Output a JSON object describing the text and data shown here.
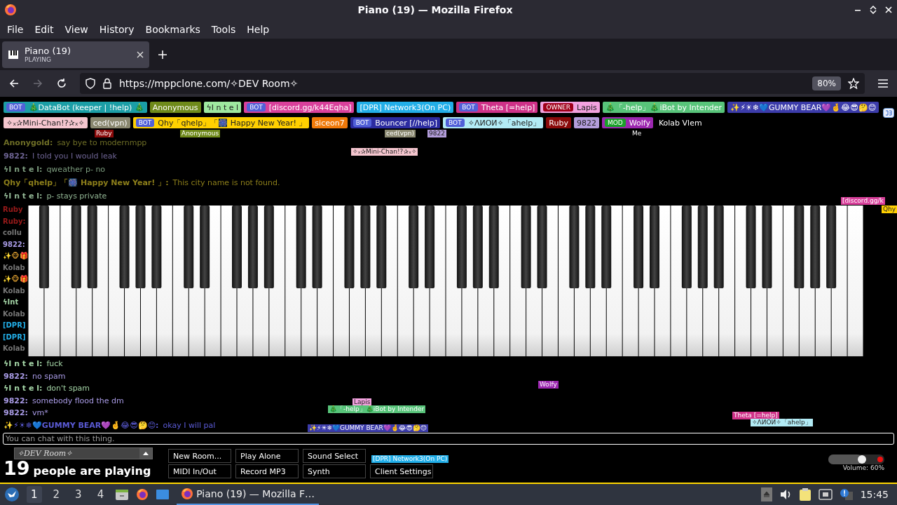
{
  "window": {
    "title": "Piano (19) — Mozilla Firefox"
  },
  "menu": [
    "File",
    "Edit",
    "View",
    "History",
    "Bookmarks",
    "Tools",
    "Help"
  ],
  "tabs": [
    {
      "title": "Piano (19)",
      "subtitle": "PLAYING",
      "selected": true
    }
  ],
  "nav": {
    "url": "https://mppclone.com/✧DEV Room✧",
    "zoom": "80%",
    "forward_disabled": true
  },
  "user_rows": [
    [
      {
        "name": "🎄DataBot (keeper | !help) 🎄",
        "color": "#1b9ea6",
        "badge": {
          "label": "BOT",
          "color": "#5160d8"
        }
      },
      {
        "name": "Anonymous",
        "color": "#6f8a1a"
      },
      {
        "name": "ϟI n t e l",
        "color": "#9fe8a0"
      },
      {
        "name": "[discord.gg/k44Eqha]",
        "color": "#d9409b",
        "badge": {
          "label": "BOT",
          "color": "#5160d8"
        }
      },
      {
        "name": "[DPR] Network3(On PC)",
        "color": "#22aee8"
      },
      {
        "name": "Theta [=help]",
        "color": "#cf3188",
        "badge": {
          "label": "BOT",
          "color": "#5160d8"
        }
      },
      {
        "name": "Lapis",
        "color": "#f3a2df",
        "badge": {
          "label": "OWNER",
          "color": "#a0001a"
        }
      },
      {
        "name": "🎄「-help」🎄iBot by Intender",
        "color": "#58c47a"
      },
      {
        "name": "✨⚡☀❄💙GUMMY BEAR💜🤞😂😎🤔😊",
        "color": "#3c3caa"
      }
    ],
    [
      {
        "name": "✧ₓ✰Mini-Chan!?✰ₓ✧",
        "color": "#f5c6cf"
      },
      {
        "name": "ced(vpn)",
        "color": "#8a8870"
      },
      {
        "name": "Qhy「qhelp」「🎆 Happy New Year! 」",
        "color": "#ffd000",
        "badge": {
          "label": "BOT",
          "color": "#5160d8"
        }
      },
      {
        "name": "siceon7",
        "color": "#f07a0a"
      },
      {
        "name": "Bouncer [//help]",
        "color": "#2c2ca0",
        "badge": {
          "label": "BOT",
          "color": "#5160d8"
        }
      },
      {
        "name": "✧ΛИОИ✧「ahelp」",
        "color": "#b2ebf5",
        "badge": {
          "label": "BOT",
          "color": "#5160d8"
        }
      },
      {
        "name": "Ruby",
        "color": "#8a0a0a"
      },
      {
        "name": "9822",
        "color": "#b39ddb"
      },
      {
        "name": "Wolfy",
        "color": "#9c27b0",
        "badge": {
          "label": "MOD",
          "color": "#1aa02a"
        }
      },
      {
        "name": "Kolab Vlem"
      }
    ]
  ],
  "chat_top": [
    {
      "name": "Anonygold:",
      "text": "say bye to modernmpp",
      "color": "#6e6e26"
    },
    {
      "name": "9822:",
      "text": "I told you I would leak",
      "color": "#6e6494"
    },
    {
      "name": "ϟI n t e l:",
      "text": "qweather p- no",
      "color": "#7c9c7e"
    },
    {
      "name": "Qhy「qhelp」「🎆 Happy New Year! 」:",
      "text": "This city name is not found.",
      "color": "#8c7e1a"
    },
    {
      "name": "ϟI n t e l:",
      "text": "p- stays private",
      "color": "#93b795"
    }
  ],
  "chat_fragments": [
    {
      "text": "Ruby",
      "color": "#9a1a1a"
    },
    {
      "text": "Ruby:",
      "color": "#9a1a1a"
    },
    {
      "text": "collu",
      "color": "#777777"
    },
    {
      "text": "9822:",
      "color": "#a99be6"
    },
    {
      "text": "✨🐵🎁",
      "color": "#e0a030"
    },
    {
      "text": "Kolab",
      "color": "#777777"
    },
    {
      "text": "✨🐵🎁",
      "color": "#e0a030"
    },
    {
      "text": "Kolab",
      "color": "#777777"
    },
    {
      "text": "ϟInt",
      "color": "#a5d6a7"
    },
    {
      "text": "Kolab",
      "color": "#777777"
    },
    {
      "text": "[DPR]",
      "color": "#22aee8"
    },
    {
      "text": "[DPR]",
      "color": "#22aee8"
    },
    {
      "text": "Kolab",
      "color": "#777777"
    }
  ],
  "chat_bottom": [
    {
      "name": "ϟI n t e l:",
      "text": "fuck",
      "color": "#a5d6a7"
    },
    {
      "name": "9822:",
      "text": "no spam",
      "color": "#a99be6"
    },
    {
      "name": "ϟI n t e l:",
      "text": "don't spam",
      "color": "#a5d6a7"
    },
    {
      "name": "9822:",
      "text": "somebody flood the dm",
      "color": "#a99be6"
    },
    {
      "name": "9822:",
      "text": "vm*",
      "color": "#a99be6"
    },
    {
      "name": "✨⚡☀❄💙GUMMY BEAR💜🤞😂😎🤔😊:",
      "text": "okay I will pal",
      "color": "#5b5bd6"
    }
  ],
  "cursors": [
    {
      "name": "✧ₓ✰Mini-Chan!?✰ₓ✧",
      "color": "#f5c6cf"
    },
    {
      "name": "[discord.gg/k",
      "color": "#d9409b"
    },
    {
      "name": "Qhy",
      "color": "#ffd000"
    },
    {
      "name": "Wolfy",
      "color": "#9c27b0"
    },
    {
      "name": "Lapis",
      "color": "#f3a2df"
    },
    {
      "name": "🎄「-help」🎄iBot by Intender",
      "color": "#58c47a"
    },
    {
      "name": "✨⚡☀❄💙GUMMY BEAR💜🤞😂😎🤔😊",
      "color": "#3c3caa"
    },
    {
      "name": "Theta [=help]",
      "color": "#cf3188"
    },
    {
      "name": "✧ΛИОИ✧「ahelp」",
      "color": "#b2ebf5"
    },
    {
      "name": "[DPR] Network3(On PC)",
      "color": "#22aee8"
    },
    {
      "name": "Ruby",
      "color": "#8a0a0a"
    },
    {
      "name": "Anonymous",
      "color": "#6f8a1a"
    },
    {
      "name": "ced(vpn)",
      "color": "#8a8870"
    },
    {
      "name": "9822",
      "color": "#b39ddb"
    },
    {
      "name": "Me"
    }
  ],
  "chat_input": {
    "placeholder": "You can chat with this thing."
  },
  "room": {
    "name": "✧DEV Room✧",
    "count": "19",
    "count_label": "people are playing"
  },
  "buttons": [
    {
      "label": "New Room..."
    },
    {
      "label": "Play Alone"
    },
    {
      "label": "Sound Select"
    },
    {
      "label": "MIDI In/Out"
    },
    {
      "label": "Record MP3"
    },
    {
      "label": "Synth"
    },
    {
      "label": "Client Settings"
    }
  ],
  "volume": {
    "level": 0.6,
    "reading": "Volume: 60%"
  },
  "taskbar": {
    "workspaces": [
      {
        "label": "1",
        "selected": true
      },
      {
        "label": "2",
        "selected": false
      },
      {
        "label": "3",
        "selected": false
      },
      {
        "label": "4",
        "selected": false
      }
    ],
    "windows": [
      {
        "title": "Piano (19) — Mozilla F…",
        "selected": true
      }
    ],
    "clock": "15:45"
  }
}
